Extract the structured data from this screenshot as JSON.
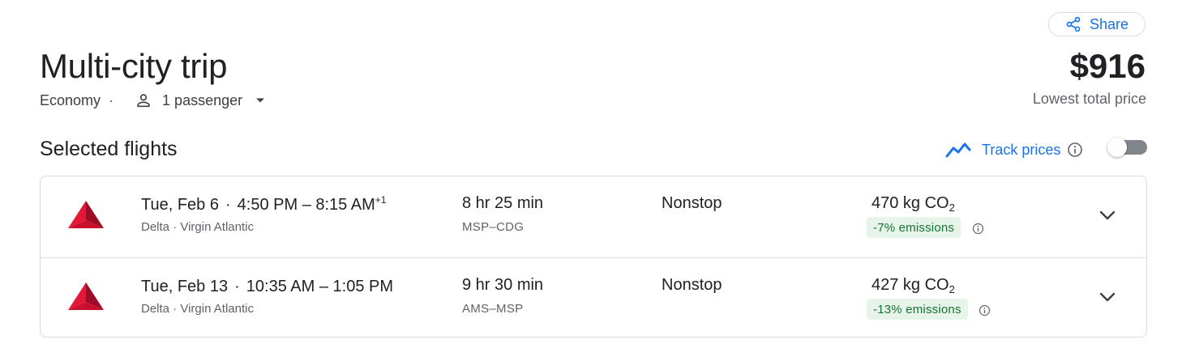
{
  "header": {
    "share_label": "Share",
    "title": "Multi-city trip",
    "cabin": "Economy",
    "dot": "·",
    "passengers": "1 passenger",
    "price": "$916",
    "price_label": "Lowest total price"
  },
  "section": {
    "title": "Selected flights",
    "track_label": "Track prices",
    "track_enabled": false
  },
  "colors": {
    "accent": "#1a73e8",
    "delta_red": "#c01933",
    "emissions_bg": "#e6f4ea",
    "emissions_text": "#137333"
  },
  "flights": [
    {
      "date": "Tue, Feb 6",
      "sep": "·",
      "time_range": "4:50 PM – 8:15 AM",
      "day_offset": "+1",
      "airlines": "Delta · Virgin Atlantic",
      "duration": "8 hr 25 min",
      "route": "MSP–CDG",
      "stops": "Nonstop",
      "co2_value": "470 kg CO",
      "co2_sub": "2",
      "emissions": "-7% emissions",
      "logo_icon": "delta-logo-icon"
    },
    {
      "date": "Tue, Feb 13",
      "sep": "·",
      "time_range": "10:35 AM – 1:05 PM",
      "day_offset": "",
      "airlines": "Delta · Virgin Atlantic",
      "duration": "9 hr 30 min",
      "route": "AMS–MSP",
      "stops": "Nonstop",
      "co2_value": "427 kg CO",
      "co2_sub": "2",
      "emissions": "-13% emissions",
      "logo_icon": "delta-logo-icon"
    }
  ]
}
